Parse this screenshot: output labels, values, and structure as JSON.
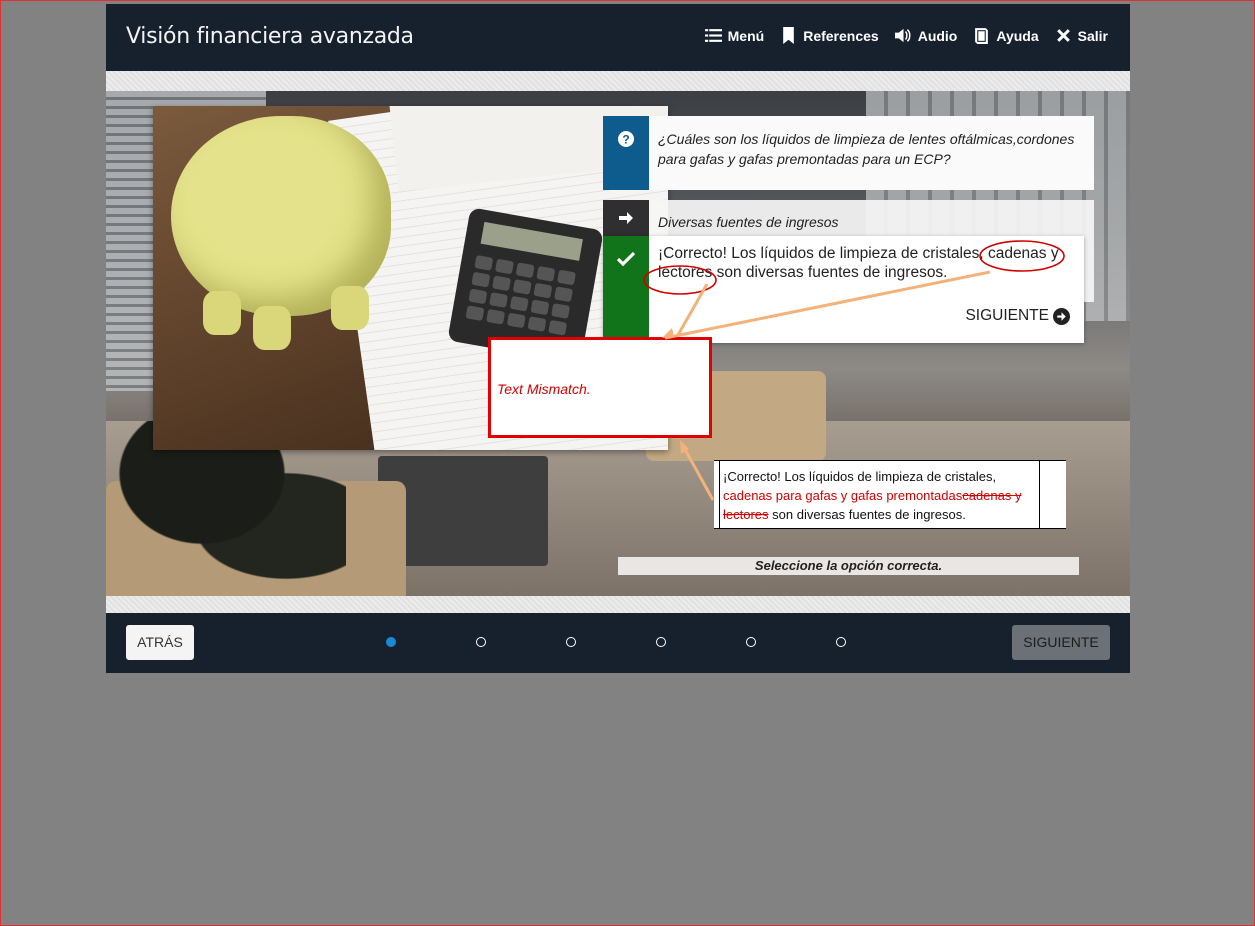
{
  "header": {
    "title": "Visión financiera avanzada",
    "nav": [
      {
        "label": "Menú",
        "icon": "list-icon"
      },
      {
        "label": "References",
        "icon": "bookmark-icon"
      },
      {
        "label": "Audio",
        "icon": "speaker-icon"
      },
      {
        "label": "Ayuda",
        "icon": "book-icon"
      },
      {
        "label": "Salir",
        "icon": "close-icon"
      }
    ]
  },
  "question": {
    "text": "¿Cuáles son los líquidos de limpieza de lentes oftálmicas,cordones para gafas y gafas premontadas para un ECP?"
  },
  "option": {
    "text": "Diversas fuentes de ingresos"
  },
  "feedback": {
    "text": "¡Correcto! Los líquidos de limpieza de cristales, cadenas y lectores son diversas fuentes de ingresos.",
    "next_label": "SIGUIENTE"
  },
  "instruction": "Seleccione la opción correcta.",
  "annotation": {
    "mismatch_label": "Text Mismatch.",
    "diff_prefix": "¡Correcto! Los líquidos de limpieza de cristales,",
    "diff_inserted": "cadenas para gafas y gafas premontadas",
    "diff_deleted": "cadenas y lectores",
    "diff_suffix": "son diversas fuentes de ingresos."
  },
  "footer": {
    "back_label": "ATRÁS",
    "next_label": "SIGUIENTE",
    "pages": 6,
    "current_page": 1
  },
  "colors": {
    "bar": "#17212e",
    "question_icon": "#0e5b8d",
    "correct_icon": "#11741a",
    "mismatch_border": "#e00000",
    "arrow": "#f3b27a"
  }
}
